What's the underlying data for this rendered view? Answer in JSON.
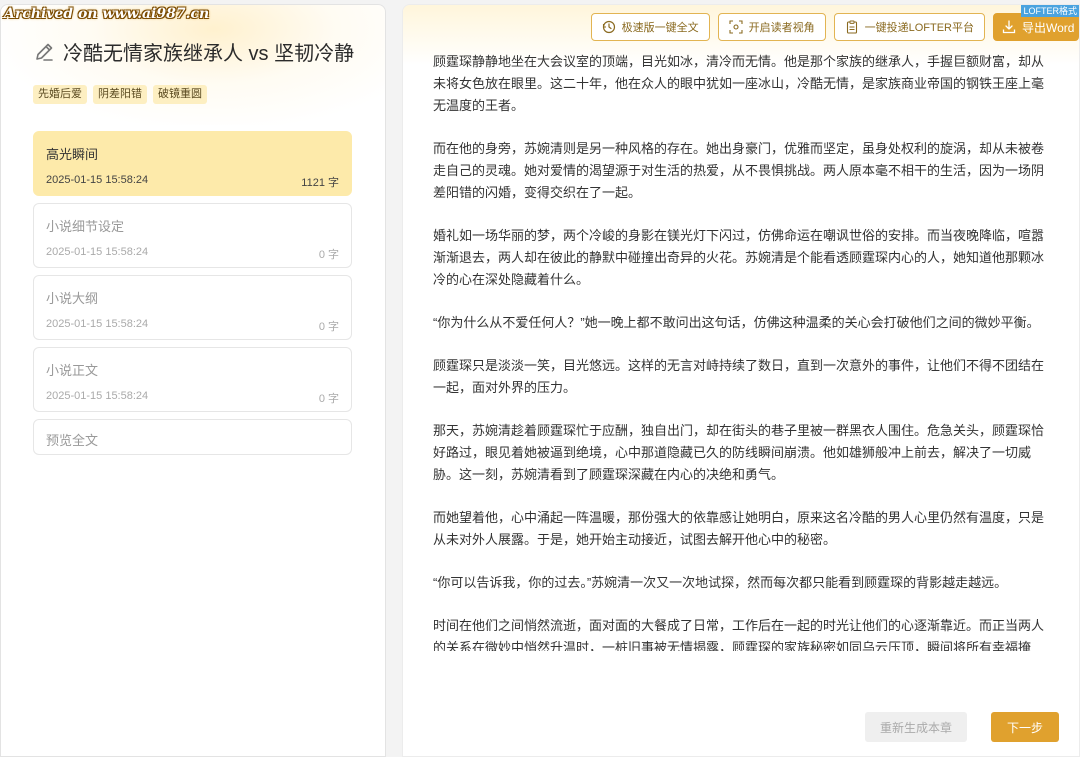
{
  "watermark": "Archived on www.ai987.cn",
  "story": {
    "title": "冷酷无情家族继承人 vs 坚韧冷静",
    "tags": [
      "先婚后爱",
      "阴差阳错",
      "破镜重圆"
    ]
  },
  "sections": [
    {
      "title": "高光瞬间",
      "date": "2025-01-15 15:58:24",
      "count": "1121 字",
      "active": true
    },
    {
      "title": "小说细节设定",
      "date": "2025-01-15 15:58:24",
      "count": "0 字",
      "active": false
    },
    {
      "title": "小说大纲",
      "date": "2025-01-15 15:58:24",
      "count": "0 字",
      "active": false
    },
    {
      "title": "小说正文",
      "date": "2025-01-15 15:58:24",
      "count": "0 字",
      "active": false
    }
  ],
  "preview_label": "预览全文",
  "toolbar": {
    "rewrite_label": "极速版一键全文",
    "reader_view_label": "开启读者视角",
    "lofter_label": "一键投递LOFTER平台",
    "export_label": "导出Word",
    "lofter_badge": "LOFTER格式"
  },
  "content": {
    "paragraphs": [
      "顾霆琛静静地坐在大会议室的顶端，目光如冰，清冷而无情。他是那个家族的继承人，手握巨额财富，却从未将女色放在眼里。这二十年，他在众人的眼中犹如一座冰山，冷酷无情，是家族商业帝国的钢铁王座上毫无温度的王者。",
      "而在他的身旁，苏婉清则是另一种风格的存在。她出身豪门，优雅而坚定，虽身处权利的旋涡，却从未被卷走自己的灵魂。她对爱情的渴望源于对生活的热爱，从不畏惧挑战。两人原本毫不相干的生活，因为一场阴差阳错的闪婚，变得交织在了一起。",
      "婚礼如一场华丽的梦，两个冷峻的身影在镁光灯下闪过，仿佛命运在嘲讽世俗的安排。而当夜晚降临，喧嚣渐渐退去，两人却在彼此的静默中碰撞出奇异的火花。苏婉清是个能看透顾霆琛内心的人，她知道他那颗冰冷的心在深处隐藏着什么。",
      "“你为什么从不爱任何人？”她一晚上都不敢问出这句话，仿佛这种温柔的关心会打破他们之间的微妙平衡。",
      "顾霆琛只是淡淡一笑，目光悠远。这样的无言对峙持续了数日，直到一次意外的事件，让他们不得不团结在一起，面对外界的压力。",
      "那天，苏婉清趁着顾霆琛忙于应酬，独自出门，却在街头的巷子里被一群黑衣人围住。危急关头，顾霆琛恰好路过，眼见着她被逼到绝境，心中那道隐藏已久的防线瞬间崩溃。他如雄狮般冲上前去，解决了一切威胁。这一刻，苏婉清看到了顾霆琛深藏在内心的决绝和勇气。",
      "而她望着他，心中涌起一阵温暖，那份强大的依靠感让她明白，原来这名冷酷的男人心里仍然有温度，只是从未对外人展露。于是，她开始主动接近，试图去解开他心中的秘密。",
      "“你可以告诉我，你的过去。”苏婉清一次又一次地试探，然而每次都只能看到顾霆琛的背影越走越远。",
      "时间在他们之间悄然流逝，面对面的大餐成了日常，工作后在一起的时光让他们的心逐渐靠近。而正当两人的关系在微妙中悄然升温时，一桩旧事被无情揭露，顾霆琛的家族秘密如同乌云压顶，瞬间将所有幸福掩埋。"
    ]
  },
  "actions": {
    "regenerate_label": "重新生成本章",
    "next_label": "下一步"
  },
  "colors": {
    "accent": "#e0a12e",
    "active_card": "#fdeaaa",
    "tag_bg": "#fdefc2"
  }
}
